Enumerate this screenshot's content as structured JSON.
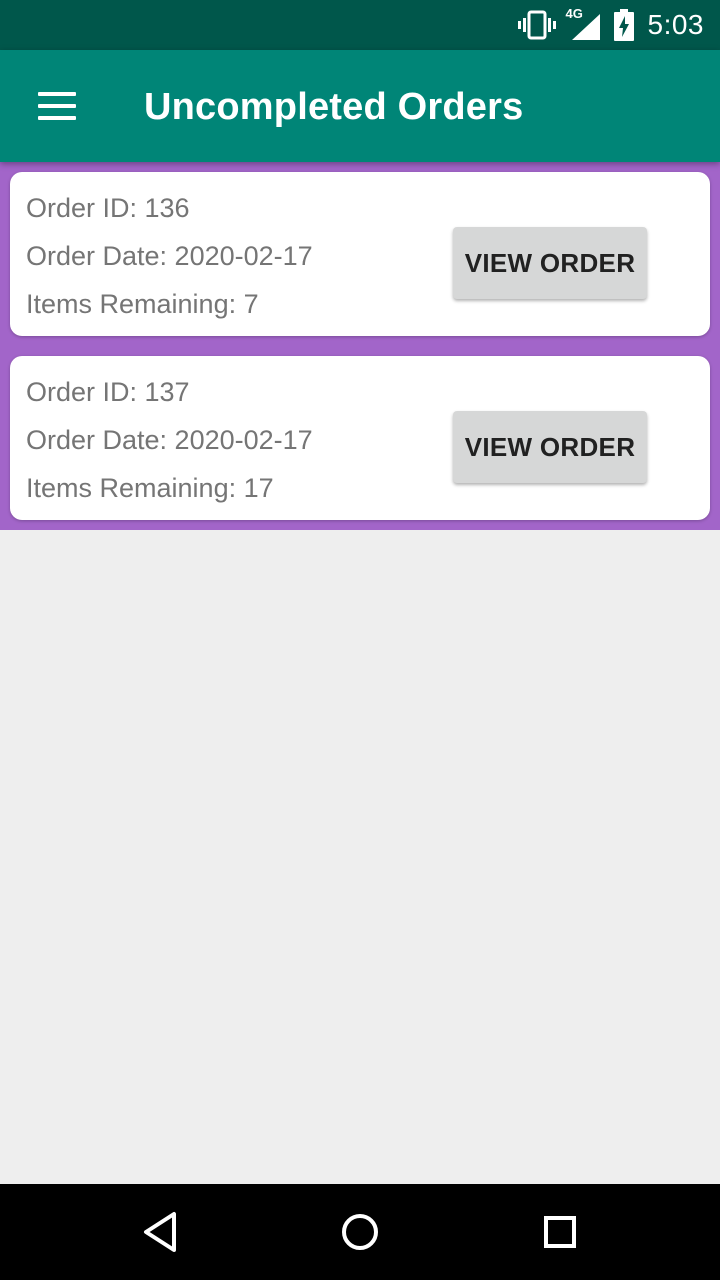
{
  "status_bar": {
    "time": "5:03",
    "network_label": "4G",
    "icons": [
      "vibrate-icon",
      "signal-icon",
      "battery-charging-icon"
    ]
  },
  "app_bar": {
    "menu_icon": "hamburger-menu-icon",
    "title": "Uncompleted Orders"
  },
  "orders": [
    {
      "id_text": "Order ID: 136",
      "date_text": "Order Date: 2020-02-17",
      "remaining_text": "Items Remaining: 7",
      "button_label": "VIEW ORDER"
    },
    {
      "id_text": "Order ID: 137",
      "date_text": "Order Date: 2020-02-17",
      "remaining_text": "Items Remaining: 17",
      "button_label": "VIEW ORDER"
    }
  ],
  "nav_bar": {
    "icons": [
      "back-icon",
      "home-icon",
      "recents-icon"
    ]
  },
  "colors": {
    "status_bar": "#00574b",
    "app_bar": "#008577",
    "list_background": "#a265c9",
    "page_background": "#eeeeee",
    "button": "#d6d7d7"
  }
}
